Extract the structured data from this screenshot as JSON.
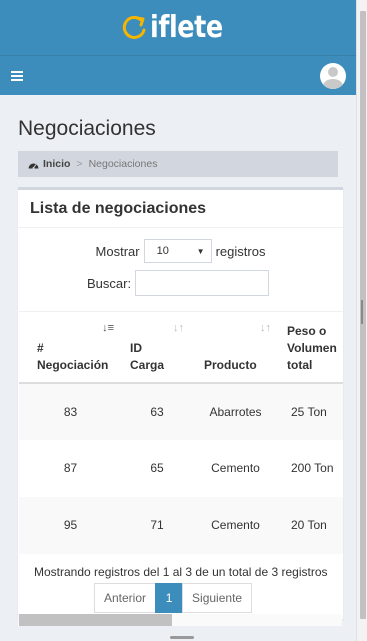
{
  "brand": {
    "name": "iflete"
  },
  "page": {
    "title": "Negociaciones"
  },
  "breadcrumb": {
    "home": "Inicio",
    "separator": ">",
    "current": "Negociaciones"
  },
  "box": {
    "title": "Lista de negociaciones"
  },
  "length_control": {
    "label_before": "Mostrar",
    "value": "10",
    "label_after": "registros"
  },
  "search": {
    "label": "Buscar:",
    "value": ""
  },
  "table": {
    "headers": [
      {
        "prefix": "#",
        "label": "Negociación"
      },
      {
        "label": "ID Carga"
      },
      {
        "label": "Producto"
      },
      {
        "label": "Peso o Volumen total"
      }
    ],
    "rows": [
      {
        "negociacion": "83",
        "id_carga": "63",
        "producto": "Abarrotes",
        "peso": "25 Ton"
      },
      {
        "negociacion": "87",
        "id_carga": "65",
        "producto": "Cemento",
        "peso": "200 Ton"
      },
      {
        "negociacion": "95",
        "id_carga": "71",
        "producto": "Cemento",
        "peso": "20 Ton"
      }
    ]
  },
  "info": "Mostrando registros del 1 al 3 de un total de 3 registros",
  "pagination": {
    "previous": "Anterior",
    "current": "1",
    "next": "Siguiente"
  },
  "colors": {
    "primary": "#3c8dbc",
    "background": "#ecf0f5",
    "breadcrumb_bg": "#d2d6de"
  }
}
